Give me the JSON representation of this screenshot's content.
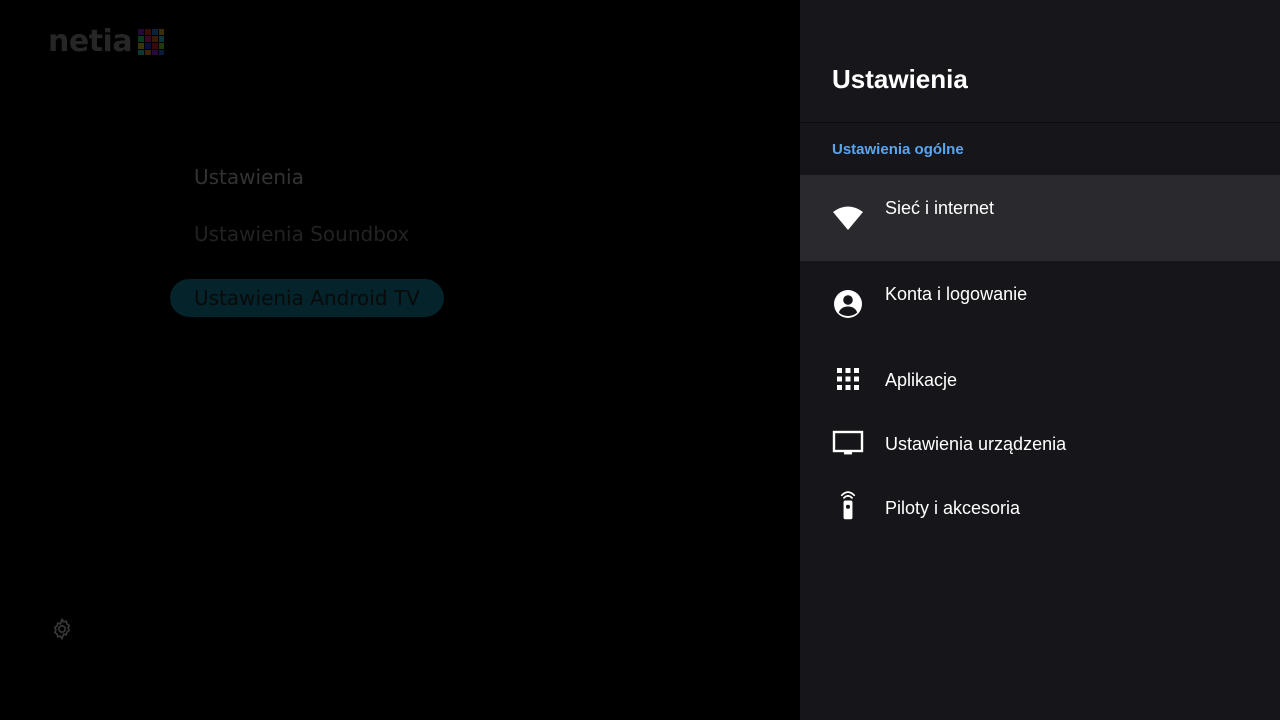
{
  "background_app": {
    "logo_text": "netia",
    "menu": [
      {
        "label": "Ustawienia"
      },
      {
        "label": "Ustawienia Soundbox"
      },
      {
        "label": "Ustawienia Android TV"
      }
    ]
  },
  "panel": {
    "title": "Ustawienia",
    "section_label": "Ustawienia ogólne",
    "items": [
      {
        "label": "Sieć i internet",
        "icon": "wifi-icon"
      },
      {
        "label": "Konta i logowanie",
        "icon": "account-icon"
      },
      {
        "label": "Aplikacje",
        "icon": "apps-grid-icon"
      },
      {
        "label": "Ustawienia urządzenia",
        "icon": "tv-icon"
      },
      {
        "label": "Piloty i akcesoria",
        "icon": "remote-icon"
      }
    ]
  },
  "colors": {
    "panel_bg": "#16161a",
    "focused_item_bg": "#2a2a2e",
    "section_accent": "#5aa5f0"
  }
}
